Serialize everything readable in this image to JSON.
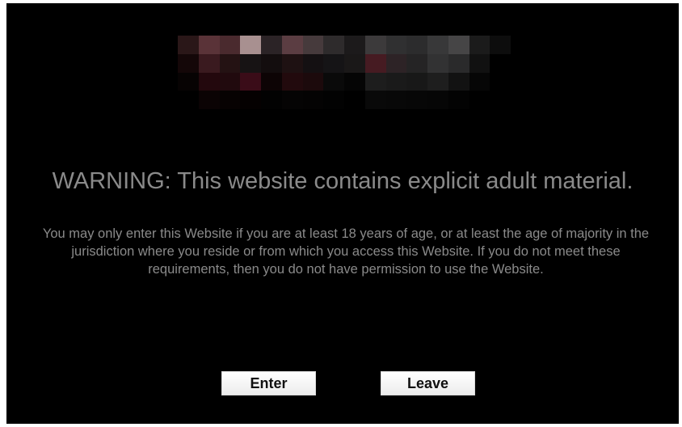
{
  "logo": {
    "alt": "pixelated site logo",
    "pixels": [
      [
        "#2a1718",
        "#5a3338",
        "#4a2a2e",
        "#a89090",
        "#2b2326",
        "#5b3d42",
        "#463a3c",
        "#2e2b2c",
        "#1c1a1b",
        "#3c3a3b",
        "#303031",
        "#2c2c2d",
        "#383839",
        "#464546",
        "#1b1b1b",
        "#0d0d0d"
      ],
      [
        "#140708",
        "#3a1a1f",
        "#241213",
        "#171314",
        "#130d0e",
        "#1e1112",
        "#141012",
        "#151416",
        "#1a1818",
        "#461b22",
        "#2d2326",
        "#252425",
        "#323233",
        "#2a2a2b",
        "#111111",
        "#000000"
      ],
      [
        "#070303",
        "#23080d",
        "#210a0e",
        "#3a0c18",
        "#0d0405",
        "#220a0d",
        "#1c0a0c",
        "#0a0a0a",
        "#050505",
        "#1d1d1d",
        "#1a1a1a",
        "#181818",
        "#1e1e1e",
        "#121212",
        "#060606",
        "#000000"
      ],
      [
        "#000000",
        "#0b0304",
        "#070202",
        "#050101",
        "#020202",
        "#050404",
        "#040303",
        "#020202",
        "#000000",
        "#090909",
        "#080808",
        "#070707",
        "#060606",
        "#030303",
        "#000000",
        "#000000"
      ]
    ]
  },
  "warning": {
    "title": "WARNING: This website contains explicit adult material.",
    "body": "You may only enter this Website if you are at least 18 years of age, or at least the age of majority in the jurisdiction where you reside or from which you access this Website. If you do not meet these requirements, then you do not have permission to use the Website."
  },
  "buttons": {
    "enter_label": "Enter",
    "leave_label": "Leave"
  },
  "colors": {
    "background": "#000000",
    "text": "#8a8a8a",
    "button_bg": "#f5f5f5"
  }
}
